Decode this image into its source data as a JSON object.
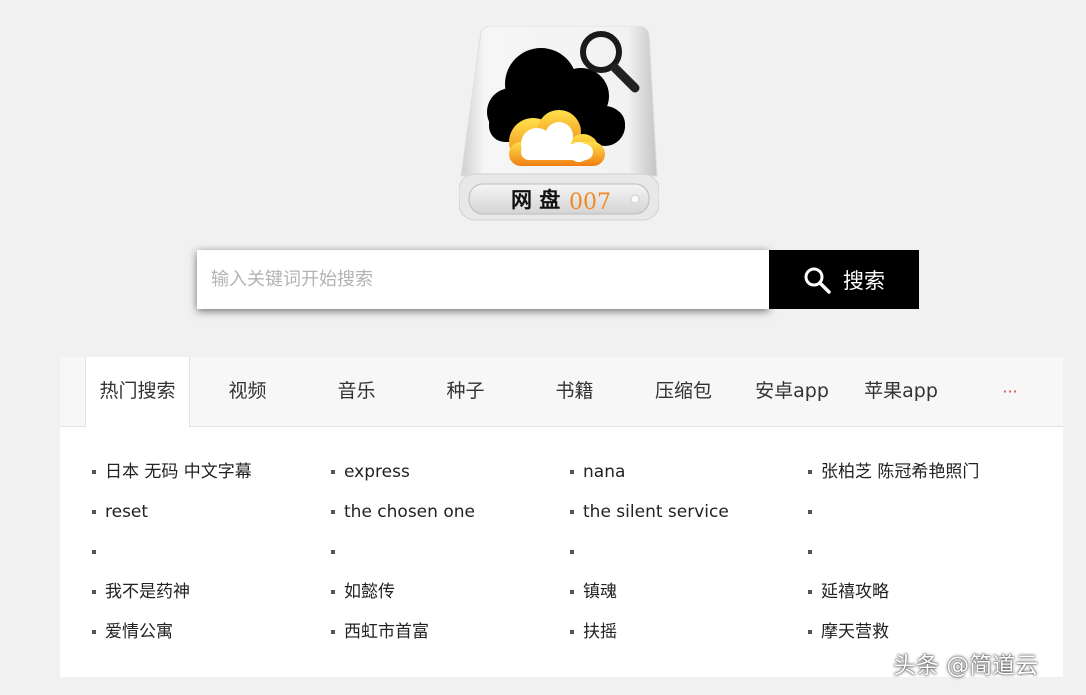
{
  "logo": {
    "text_main": "网 盘",
    "text_num": "007",
    "num_color": "#f08a24"
  },
  "search": {
    "placeholder": "输入关键词开始搜索",
    "value": "",
    "button_label": "搜索"
  },
  "tabs": [
    {
      "label": "热门搜索",
      "active": true
    },
    {
      "label": "视频"
    },
    {
      "label": "音乐"
    },
    {
      "label": "种子"
    },
    {
      "label": "书籍"
    },
    {
      "label": "压缩包"
    },
    {
      "label": "安卓app"
    },
    {
      "label": "苹果app"
    },
    {
      "label": "···"
    }
  ],
  "hot_keywords": [
    [
      "日本 无码 中文字幕",
      "express",
      "nana",
      "张柏芝 陈冠希艳照门"
    ],
    [
      "reset",
      "the chosen one",
      "the silent service",
      ""
    ],
    [
      "",
      "",
      "",
      ""
    ],
    [
      "我不是药神",
      "如懿传",
      "镇魂",
      "延禧攻略"
    ],
    [
      "爱情公寓",
      "西虹市首富",
      "扶摇",
      "摩天营救"
    ]
  ],
  "watermark": "头条 @简道云",
  "colors": {
    "background": "#f1f1f1",
    "button": "#000000",
    "more": "#e0463f"
  }
}
